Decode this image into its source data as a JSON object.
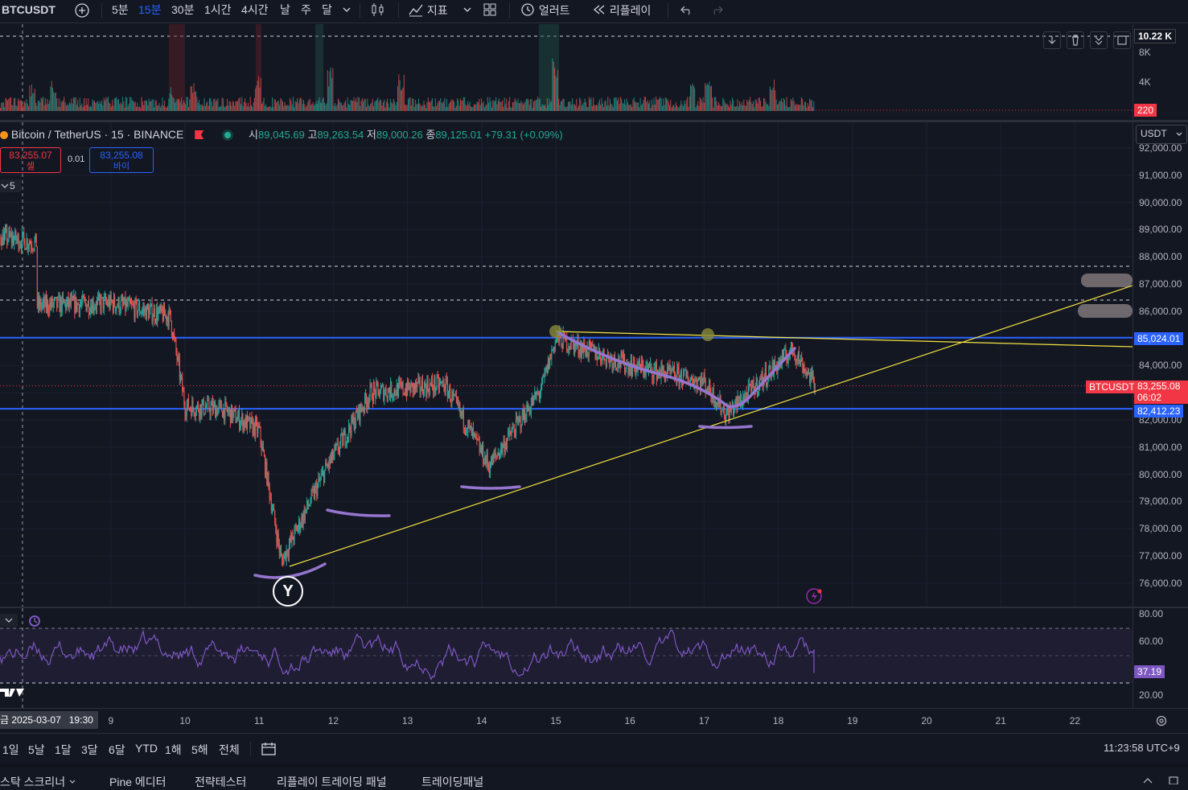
{
  "toolbar": {
    "symbol": "BTCUSDT",
    "timeframes": [
      "5분",
      "15분",
      "30분",
      "1시간",
      "4시간",
      "날",
      "주",
      "달"
    ],
    "active_timeframe": "15분",
    "indicators_label": "지표",
    "alert_label": "얼러트",
    "replay_label": "리플레이"
  },
  "legend": {
    "title": "Bitcoin / TetherUS · 15 · BINANCE",
    "open_label": "시",
    "open": "89,045.69",
    "high_label": "고",
    "high": "89,263.54",
    "low_label": "저",
    "low": "89,000.26",
    "close_label": "종",
    "close": "89,125.01",
    "change": "+79.31 (+0.09%)",
    "currency": "USDT"
  },
  "trade": {
    "sell_price": "83,255.07",
    "sell_label": "셀",
    "spread": "0.01",
    "buy_price": "83,255.08",
    "buy_label": "바이",
    "collapse_count": "5"
  },
  "volume_axis": {
    "labels": [
      "10.22 K",
      "8K",
      "4K"
    ],
    "current": "220"
  },
  "price_axis": {
    "ticks": [
      92000,
      91000,
      90000,
      89000,
      88000,
      87000,
      86000,
      85000,
      84000,
      83000,
      82000,
      81000,
      80000,
      79000,
      78000,
      77000,
      76000
    ],
    "tick_labels": [
      "92,000.00",
      "91,000.00",
      "90,000.00",
      "89,000.00",
      "88,000.00",
      "87,000.00",
      "86,000.00",
      "84,000.00",
      "82,000.00",
      "81,000.00",
      "80,000.00",
      "79,000.00",
      "78,000.00",
      "77,000.00",
      "76,000.00"
    ],
    "hline_upper": "85,024.01",
    "hline_lower": "82,412.23",
    "last_symbol": "BTCUSDT",
    "last_price": "83,255.08",
    "countdown": "06:02"
  },
  "rsi_axis": {
    "labels": [
      "80.00",
      "60.00",
      "20.00"
    ],
    "value": "37.19"
  },
  "time_axis": {
    "crosshair_label": "금 2025-03-07   19:30",
    "labels": [
      "9",
      "10",
      "11",
      "12",
      "13",
      "14",
      "15",
      "16",
      "17",
      "18",
      "19",
      "20",
      "21",
      "22"
    ]
  },
  "annotations": {
    "pattern_marker": "Y"
  },
  "ranges": [
    "1일",
    "5날",
    "1달",
    "3달",
    "6달",
    "YTD",
    "1해",
    "5해",
    "전체"
  ],
  "clock": "11:23:58 UTC+9",
  "panel_tabs": [
    "스탁 스크리너",
    "Pine 에디터",
    "전략테스터",
    "리플레이 트레이딩 패널",
    "트레이딩패널"
  ],
  "chart_data": {
    "type": "candlestick",
    "symbol": "BTCUSDT",
    "interval": "15",
    "x": [
      "9",
      "10",
      "11",
      "12",
      "13",
      "14",
      "15",
      "16",
      "17",
      "18",
      "19",
      "20",
      "21",
      "22"
    ],
    "ylim": [
      75500,
      92200
    ],
    "horizontal_lines": [
      85024.01,
      82412.23
    ],
    "last_price": 83255.08,
    "approx_path": [
      {
        "x": "7",
        "y": 89000
      },
      {
        "x": "8",
        "y": 88500
      },
      {
        "x": "8",
        "y": 86200
      },
      {
        "x": "9",
        "y": 86300
      },
      {
        "x": "9.8",
        "y": 85800
      },
      {
        "x": "10",
        "y": 82500
      },
      {
        "x": "10.5",
        "y": 82400
      },
      {
        "x": "11",
        "y": 81600
      },
      {
        "x": "11.3",
        "y": 76800
      },
      {
        "x": "11.9",
        "y": 80200
      },
      {
        "x": "12.5",
        "y": 83000
      },
      {
        "x": "13.5",
        "y": 83300
      },
      {
        "x": "14.1",
        "y": 80300
      },
      {
        "x": "14.8",
        "y": 83100
      },
      {
        "x": "15",
        "y": 85000
      },
      {
        "x": "16",
        "y": 84000
      },
      {
        "x": "17",
        "y": 83400
      },
      {
        "x": "17.3",
        "y": 82200
      },
      {
        "x": "18.2",
        "y": 84600
      },
      {
        "x": "18.5",
        "y": 83255
      }
    ],
    "rsi": {
      "last": 37.19,
      "levels": [
        70,
        30
      ]
    }
  }
}
